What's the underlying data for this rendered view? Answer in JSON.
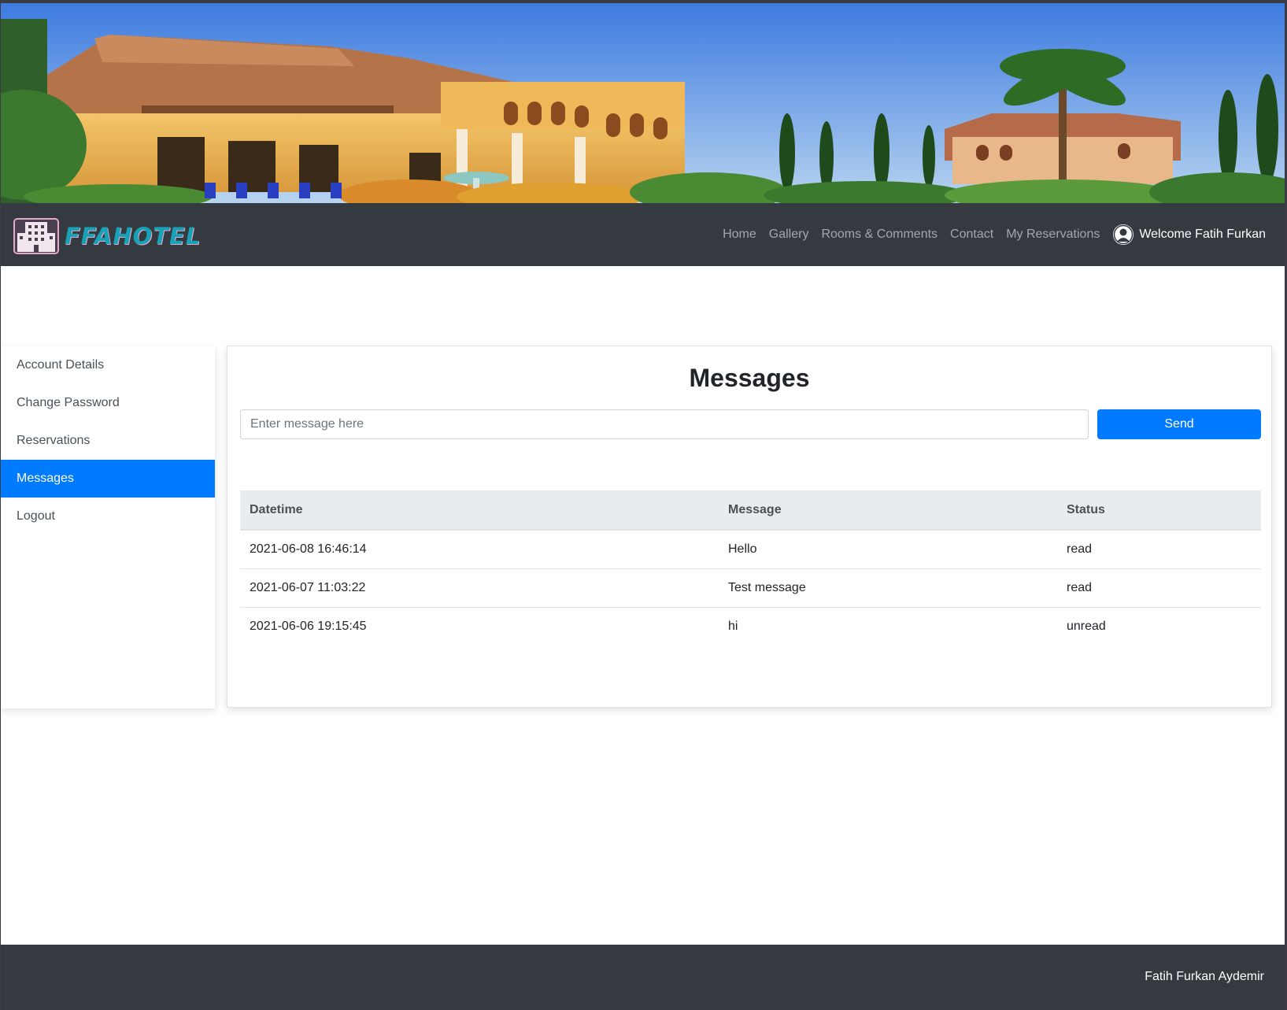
{
  "brand": {
    "name": "FFAHOTEL"
  },
  "nav": {
    "links": [
      "Home",
      "Gallery",
      "Rooms & Comments",
      "Contact",
      "My Reservations"
    ],
    "welcome": "Welcome Fatih Furkan"
  },
  "sidebar": {
    "items": [
      {
        "label": "Account Details",
        "active": false
      },
      {
        "label": "Change Password",
        "active": false
      },
      {
        "label": "Reservations",
        "active": false
      },
      {
        "label": "Messages",
        "active": true
      },
      {
        "label": "Logout",
        "active": false
      }
    ]
  },
  "main": {
    "title": "Messages",
    "input": {
      "placeholder": "Enter message here",
      "value": ""
    },
    "send_label": "Send",
    "table": {
      "headers": [
        "Datetime",
        "Message",
        "Status"
      ],
      "rows": [
        [
          "2021-06-08 16:46:14",
          "Hello",
          "read"
        ],
        [
          "2021-06-07 11:03:22",
          "Test message",
          "read"
        ],
        [
          "2021-06-06 19:15:45",
          "hi",
          "unread"
        ]
      ]
    }
  },
  "footer": {
    "text": "Fatih Furkan Aydemir"
  },
  "colors": {
    "primary": "#007bff",
    "navbar": "#343a40",
    "brand": "#17a2b8"
  }
}
